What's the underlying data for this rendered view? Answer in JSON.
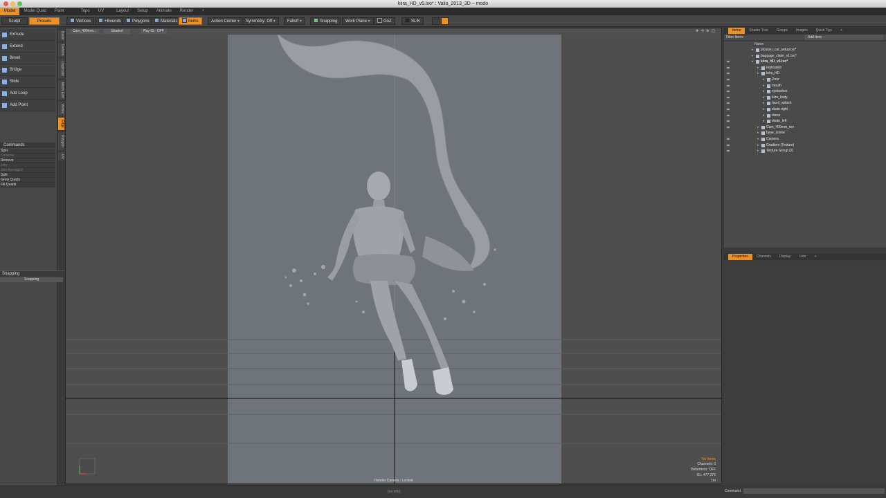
{
  "window": {
    "title": "kiira_HD_v5.lxo* : Valio_2013_3D – modo"
  },
  "menu_tabs": [
    "Model",
    "Model Quad",
    "Paint",
    "Topo",
    "UV",
    "Layout",
    "Setup",
    "Animate",
    "Render",
    "+"
  ],
  "toolbar": {
    "sculpt": "Sculpt",
    "presets": "Presets",
    "vertices": "Vertices",
    "bounds": "+Bounds",
    "polygons": "Polygons",
    "materials": "Materials",
    "items": "Items",
    "action_center": "Action Center",
    "symmetry": "Symmetry: Off",
    "falloff": "Falloff",
    "snapping": "Snapping",
    "work_plane": "Work Plane",
    "goz": "GoZ",
    "slik": "SLIK"
  },
  "tools": [
    "Extrude",
    "Extend",
    "Bevel",
    "Bridge",
    "Slide",
    "Add Loop",
    "Add Point"
  ],
  "commands": {
    "header": "Commands",
    "items": [
      {
        "label": "Spin",
        "dim": false
      },
      {
        "label": "Collapse",
        "dim": true
      },
      {
        "label": "Remove",
        "dim": false
      },
      {
        "label": "Join",
        "dim": true
      },
      {
        "label": "Join Averaged",
        "dim": true
      },
      {
        "label": "Split",
        "dim": false
      },
      {
        "label": "Grow Quads",
        "dim": false
      },
      {
        "label": "Fill Quads",
        "dim": false
      }
    ]
  },
  "side_tabs": [
    "Basic",
    "Deform",
    "Duplicate",
    "Mesh Edit",
    "Vertex",
    "Edge",
    "Polygon",
    "UV"
  ],
  "snapping_panel": {
    "header": "Snapping",
    "row": "Snapping"
  },
  "viewport": {
    "camera": "Cam_400mm...",
    "shading": "Shaded",
    "gl": "Ray GL: OFF",
    "render_caption": "Render Camera : Locked",
    "info": [
      "No Items",
      "Channels: 0",
      "Deformers: OFF",
      "GL: 477,376",
      "1m"
    ]
  },
  "right_panel": {
    "tabs": [
      "Items",
      "Shader Tree",
      "Groups",
      "Images",
      "Quick Tips",
      "+"
    ],
    "filter": "Filter Items",
    "add_item": "Add Item",
    "col_name": "Name",
    "tree": [
      {
        "label": "picasso_car_setup.lxo*",
        "indent": 0,
        "eye": false,
        "bold": false
      },
      {
        "label": "baggage_claim_v1.lxo*",
        "indent": 0,
        "eye": false,
        "bold": false
      },
      {
        "label": "kiira_HD_v5.lxo*",
        "indent": 0,
        "eye": true,
        "bold": true
      },
      {
        "label": "replicated",
        "indent": 1,
        "eye": true,
        "bold": false
      },
      {
        "label": "kiira_HD",
        "indent": 1,
        "eye": true,
        "bold": false
      },
      {
        "label": "Pour",
        "indent": 2,
        "eye": true,
        "bold": false
      },
      {
        "label": "mouth",
        "indent": 2,
        "eye": true,
        "bold": false
      },
      {
        "label": "eyelashes",
        "indent": 2,
        "eye": true,
        "bold": false
      },
      {
        "label": "kiira_body",
        "indent": 2,
        "eye": true,
        "bold": false
      },
      {
        "label": "hand_splash",
        "indent": 2,
        "eye": true,
        "bold": false
      },
      {
        "label": "skate right",
        "indent": 2,
        "eye": true,
        "bold": false
      },
      {
        "label": "dress",
        "indent": 2,
        "eye": true,
        "bold": false
      },
      {
        "label": "skate_left",
        "indent": 2,
        "eye": true,
        "bold": false
      },
      {
        "label": "Cam_400mm_ren",
        "indent": 1,
        "eye": true,
        "bold": false
      },
      {
        "label": "base_scene",
        "indent": 1,
        "eye": false,
        "bold": false
      },
      {
        "label": "Camera",
        "indent": 1,
        "eye": true,
        "bold": false
      },
      {
        "label": "Gradient (Texture)",
        "indent": 1,
        "eye": true,
        "bold": false
      },
      {
        "label": "Texture Group (2)",
        "indent": 1,
        "eye": true,
        "bold": false
      }
    ],
    "props_tabs": [
      "Properties",
      "Channels",
      "Display",
      "Lists",
      "+"
    ]
  },
  "status": {
    "info": "(no info)",
    "command_label": "Command"
  },
  "colors": {
    "accent": "#e8912a",
    "camera_bg": "#6f737a",
    "viewport_bg": "#4e4e4e"
  }
}
